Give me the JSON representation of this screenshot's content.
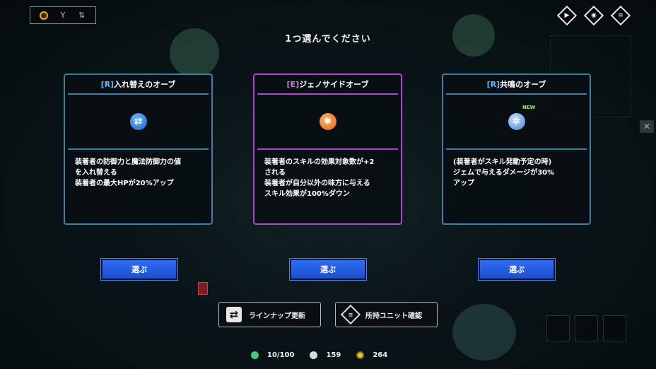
{
  "header": {
    "prompt": "1つ選んでください"
  },
  "top_tabs": [
    {
      "icon": "orb-tab-icon"
    },
    {
      "icon": "goblet-tab-icon"
    },
    {
      "icon": "sort-tab-icon"
    }
  ],
  "top_right_buttons": [
    {
      "icon": "play-icon",
      "glyph": "▶"
    },
    {
      "icon": "map-pin-icon",
      "glyph": "◉"
    },
    {
      "icon": "menu-icon",
      "glyph": "≡"
    }
  ],
  "cards": [
    {
      "rarity": "[R]",
      "name": "入れ替えのオーブ",
      "icon_glyph": "⇄",
      "description": "装着者の防御力と魔法防御力の値\nを入れ替える\n装着者の最大HPが20%アップ",
      "choose_label": "選ぶ"
    },
    {
      "rarity": "[E]",
      "name": "ジェノサイドオーブ",
      "icon_glyph": "✹",
      "description": "装着者のスキルの効果対象数が+2\nされる\n装着者が自分以外の味方に与える\nスキル効果が100%ダウン",
      "choose_label": "選ぶ"
    },
    {
      "rarity": "[R]",
      "name": "共鳴のオーブ",
      "icon_glyph": "✲",
      "new_badge": "NEW",
      "description": "(装着者がスキル発動予定の時)\nジェムで与えるダメージが30%\nアップ",
      "choose_label": "選ぶ"
    }
  ],
  "actions": {
    "refresh_label": "ラインナップ更新",
    "units_label": "所持ユニット確認"
  },
  "stats": {
    "units": "10/100",
    "second": "159",
    "gold": "264"
  },
  "colors": {
    "rare_border": "#3d7fa6",
    "epic_border": "#a94cc6",
    "button_blue": "#2f6cf2"
  }
}
